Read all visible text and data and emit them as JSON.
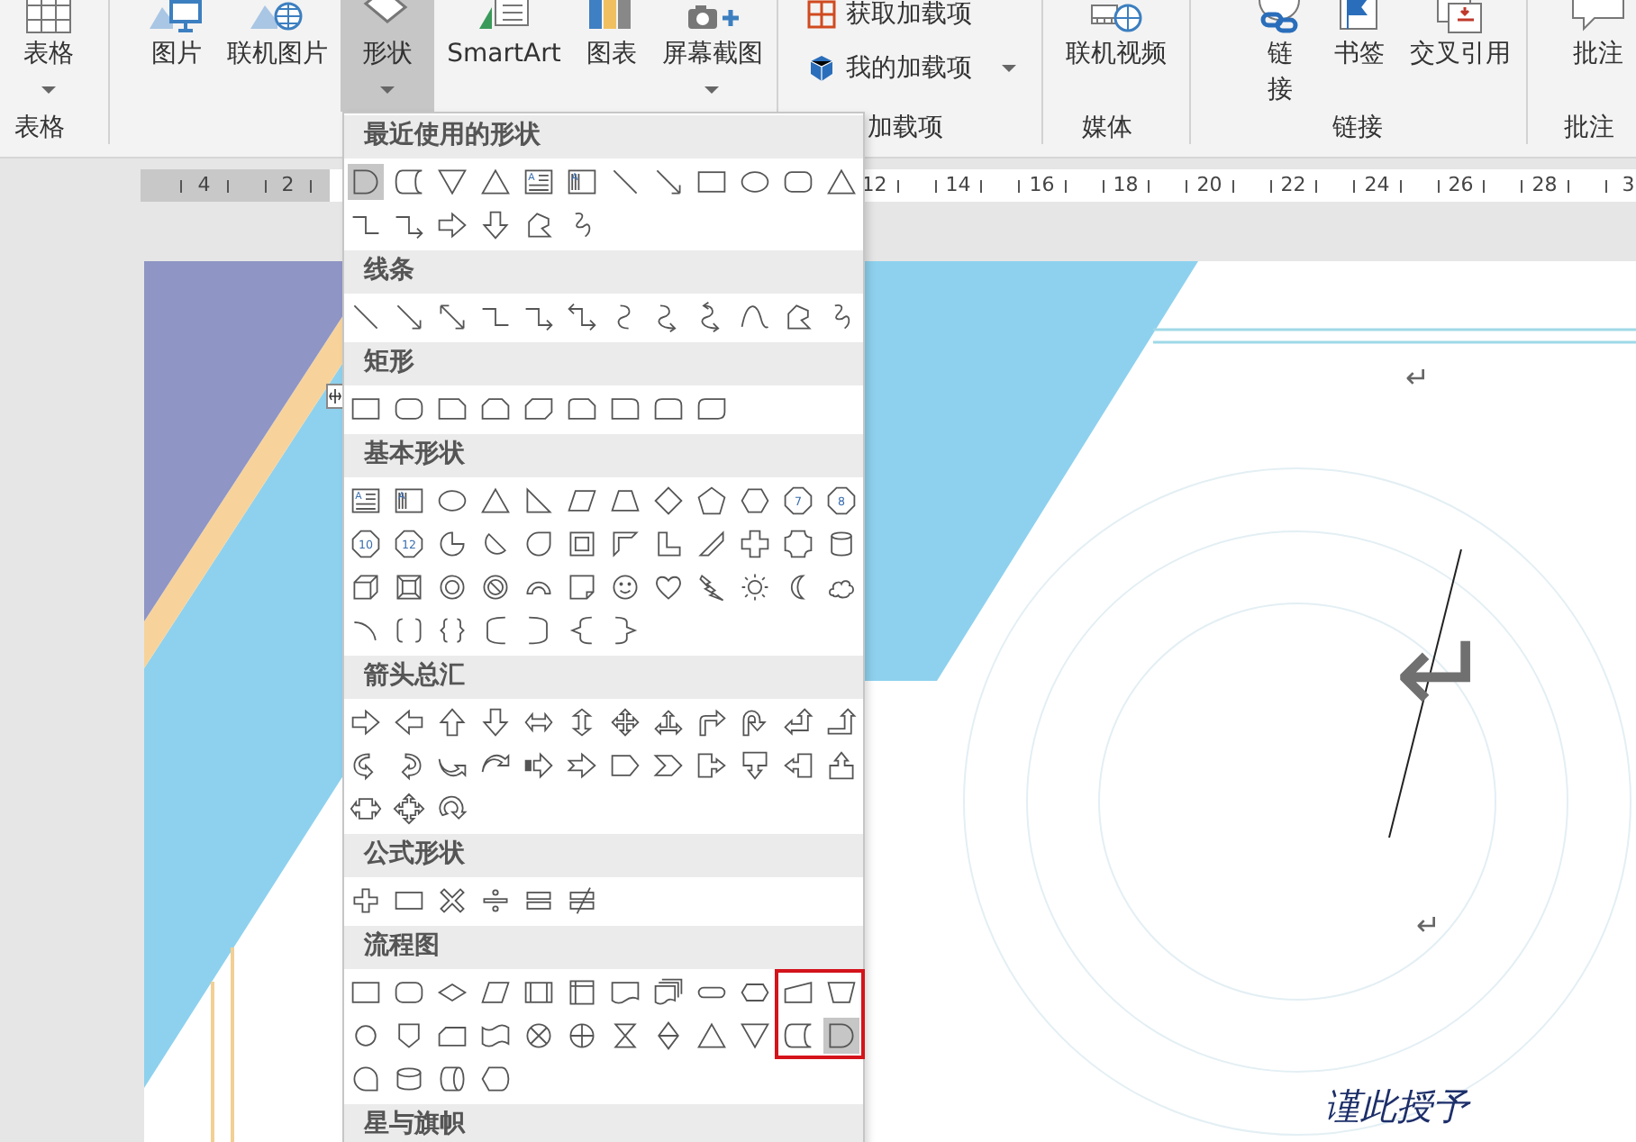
{
  "ribbon": {
    "groups": [
      {
        "label": "表格",
        "buttons": [
          {
            "label": "表格",
            "kind": "table",
            "compact": false,
            "dropdown": true,
            "pressed": false
          }
        ]
      },
      {
        "buttons": [
          {
            "label": "图片",
            "kind": "picture",
            "compact": false,
            "dropdown": false,
            "pressed": false
          },
          {
            "label": "联机图片",
            "kind": "globe-picture",
            "compact": false,
            "dropdown": false,
            "pressed": false
          },
          {
            "label": "形状",
            "kind": "diamond",
            "compact": false,
            "dropdown": true,
            "pressed": true
          },
          {
            "label": "SmartArt",
            "kind": "diagram",
            "compact": false,
            "dropdown": false,
            "pressed": false
          },
          {
            "label": "图表",
            "kind": "bar-chart",
            "compact": false,
            "dropdown": false,
            "pressed": false
          },
          {
            "label": "屏幕截图",
            "kind": "camera",
            "compact": false,
            "dropdown": true,
            "pressed": false
          }
        ]
      },
      {
        "label": "加载项",
        "buttons": [
          {
            "label": "获取加载项",
            "kind": "store",
            "compact": true,
            "dropdown": false,
            "pressed": false
          },
          {
            "label": "我的加载项",
            "kind": "cube",
            "compact": true,
            "dropdown": true,
            "pressed": false
          }
        ]
      },
      {
        "label": "媒体",
        "buttons": [
          {
            "label": "联机视频",
            "kind": "film-globe",
            "compact": false,
            "dropdown": false,
            "pressed": false
          }
        ]
      },
      {
        "label": "链接",
        "buttons": [
          {
            "label": "链接",
            "kind": "chain-link",
            "compact": false,
            "dropdown": false,
            "pressed": false
          },
          {
            "label": "书签",
            "kind": "bookmark",
            "compact": false,
            "dropdown": false,
            "pressed": false
          },
          {
            "label": "交叉引用",
            "kind": "documents",
            "compact": false,
            "dropdown": false,
            "pressed": false
          }
        ]
      },
      {
        "label": "批注",
        "buttons": [
          {
            "label": "批注",
            "kind": "speech-bubble",
            "compact": false,
            "dropdown": false,
            "pressed": false
          }
        ]
      }
    ]
  },
  "ruler": {
    "left_labels": [
      "4",
      "2"
    ],
    "right_labels": [
      "12",
      "14",
      "16",
      "18",
      "20",
      "22",
      "24",
      "26",
      "28",
      "3"
    ]
  },
  "document": {
    "marks": [
      {
        "text": "↵",
        "kind": "paragraph"
      },
      {
        "text": "↵",
        "kind": "large"
      },
      {
        "text": "↵",
        "kind": "paragraph"
      }
    ],
    "text": "谨此授予"
  },
  "menu": {
    "sections": [
      {
        "title": "最近使用的形状",
        "shapes": [
          {
            "kind": "delay",
            "selected": true
          },
          {
            "kind": "stored-data",
            "selected": false
          },
          {
            "kind": "merge-triangle",
            "selected": false
          },
          {
            "kind": "triangle",
            "selected": false
          },
          {
            "kind": "text-box",
            "label": "A",
            "selected": false
          },
          {
            "kind": "vertical-text-box",
            "label": "A",
            "selected": false
          },
          {
            "kind": "line",
            "selected": false
          },
          {
            "kind": "arrow-line",
            "selected": false
          },
          {
            "kind": "rectangle",
            "selected": false
          },
          {
            "kind": "oval",
            "selected": false
          },
          {
            "kind": "rounded-rectangle",
            "selected": false
          },
          {
            "kind": "triangle",
            "selected": false
          },
          {
            "kind": "elbow-connector",
            "selected": false
          },
          {
            "kind": "elbow-arrow",
            "selected": false
          },
          {
            "kind": "right-arrow",
            "selected": false
          },
          {
            "kind": "down-arrow",
            "selected": false
          },
          {
            "kind": "freeform",
            "selected": false
          },
          {
            "kind": "scribble",
            "selected": false
          }
        ]
      },
      {
        "title": "线条",
        "shapes": [
          {
            "kind": "line",
            "selected": false
          },
          {
            "kind": "arrow-line",
            "selected": false
          },
          {
            "kind": "double-arrow-line",
            "selected": false
          },
          {
            "kind": "elbow-connector",
            "selected": false
          },
          {
            "kind": "elbow-arrow",
            "selected": false
          },
          {
            "kind": "elbow-double-arrow",
            "selected": false
          },
          {
            "kind": "curve",
            "selected": false
          },
          {
            "kind": "curved-arrow-line",
            "selected": false
          },
          {
            "kind": "curved-double-arrow-line",
            "selected": false
          },
          {
            "kind": "arch-curve",
            "selected": false
          },
          {
            "kind": "freeform",
            "selected": false
          },
          {
            "kind": "scribble",
            "selected": false
          }
        ]
      },
      {
        "title": "矩形",
        "shapes": [
          {
            "kind": "rectangle",
            "selected": false
          },
          {
            "kind": "rounded-rectangle",
            "selected": false
          },
          {
            "kind": "snip-corner",
            "selected": false
          },
          {
            "kind": "snip-same-side",
            "selected": false
          },
          {
            "kind": "snip-diagonal",
            "selected": false
          },
          {
            "kind": "snip-round",
            "selected": false
          },
          {
            "kind": "round-corner",
            "selected": false
          },
          {
            "kind": "round-same-side",
            "selected": false
          },
          {
            "kind": "round-diagonal",
            "selected": false
          }
        ]
      },
      {
        "title": "基本形状",
        "shapes": [
          {
            "kind": "text-box",
            "label": "A",
            "selected": false
          },
          {
            "kind": "vertical-text-box",
            "label": "A",
            "selected": false
          },
          {
            "kind": "oval",
            "selected": false
          },
          {
            "kind": "triangle",
            "selected": false
          },
          {
            "kind": "right-triangle",
            "selected": false
          },
          {
            "kind": "parallelogram",
            "selected": false
          },
          {
            "kind": "trapezoid",
            "selected": false
          },
          {
            "kind": "diamond",
            "selected": false
          },
          {
            "kind": "pentagon",
            "selected": false
          },
          {
            "kind": "hexagon",
            "selected": false
          },
          {
            "kind": "numbered-polygon",
            "label": "7",
            "selected": false
          },
          {
            "kind": "numbered-polygon",
            "label": "8",
            "selected": false
          },
          {
            "kind": "numbered-polygon",
            "label": "10",
            "selected": false
          },
          {
            "kind": "numbered-polygon",
            "label": "12",
            "selected": false
          },
          {
            "kind": "pie",
            "selected": false
          },
          {
            "kind": "chord",
            "selected": false
          },
          {
            "kind": "teardrop",
            "selected": false
          },
          {
            "kind": "frame",
            "selected": false
          },
          {
            "kind": "half-frame",
            "selected": false
          },
          {
            "kind": "l-shape",
            "selected": false
          },
          {
            "kind": "diagonal-stripe",
            "selected": false
          },
          {
            "kind": "cross",
            "selected": false
          },
          {
            "kind": "plaque",
            "selected": false
          },
          {
            "kind": "cylinder",
            "selected": false
          },
          {
            "kind": "cube",
            "selected": false
          },
          {
            "kind": "bevel",
            "selected": false
          },
          {
            "kind": "donut",
            "selected": false
          },
          {
            "kind": "no-symbol",
            "selected": false
          },
          {
            "kind": "block-arc",
            "selected": false
          },
          {
            "kind": "folded-corner",
            "selected": false
          },
          {
            "kind": "smiley",
            "selected": false
          },
          {
            "kind": "heart",
            "selected": false
          },
          {
            "kind": "lightning",
            "selected": false
          },
          {
            "kind": "sun",
            "selected": false
          },
          {
            "kind": "moon",
            "selected": false
          },
          {
            "kind": "cloud",
            "selected": false
          },
          {
            "kind": "arc",
            "selected": false
          },
          {
            "kind": "bracket-pair",
            "selected": false
          },
          {
            "kind": "brace-pair",
            "selected": false
          },
          {
            "kind": "left-bracket",
            "selected": false
          },
          {
            "kind": "right-bracket",
            "selected": false
          },
          {
            "kind": "left-brace",
            "selected": false
          },
          {
            "kind": "right-brace",
            "selected": false
          }
        ]
      },
      {
        "title": "箭头总汇",
        "shapes": [
          {
            "kind": "right-arrow",
            "selected": false
          },
          {
            "kind": "left-arrow",
            "selected": false
          },
          {
            "kind": "up-arrow",
            "selected": false
          },
          {
            "kind": "down-arrow",
            "selected": false
          },
          {
            "kind": "left-right-arrow",
            "selected": false
          },
          {
            "kind": "up-down-arrow",
            "selected": false
          },
          {
            "kind": "quad-arrow",
            "selected": false
          },
          {
            "kind": "left-right-up-arrow",
            "selected": false
          },
          {
            "kind": "bent-arrow",
            "selected": false
          },
          {
            "kind": "u-turn-arrow",
            "selected": false
          },
          {
            "kind": "left-up-arrow",
            "selected": false
          },
          {
            "kind": "bent-up-arrow",
            "selected": false
          },
          {
            "kind": "curved-right-arrow",
            "selected": false
          },
          {
            "kind": "curved-left-arrow",
            "selected": false
          },
          {
            "kind": "curved-up-arrow",
            "selected": false
          },
          {
            "kind": "curved-down-arrow",
            "selected": false
          },
          {
            "kind": "striped-arrow",
            "selected": false
          },
          {
            "kind": "notched-arrow",
            "selected": false
          },
          {
            "kind": "pentagon-arrow",
            "selected": false
          },
          {
            "kind": "chevron",
            "selected": false
          },
          {
            "kind": "right-callout-arrow",
            "selected": false
          },
          {
            "kind": "down-callout-arrow",
            "selected": false
          },
          {
            "kind": "left-callout-arrow",
            "selected": false
          },
          {
            "kind": "up-callout-arrow",
            "selected": false
          },
          {
            "kind": "left-right-callout-arrow",
            "selected": false
          },
          {
            "kind": "quad-callout-arrow",
            "selected": false
          },
          {
            "kind": "circular-arrow",
            "selected": false
          }
        ]
      },
      {
        "title": "公式形状",
        "shapes": [
          {
            "kind": "plus-sign",
            "selected": false
          },
          {
            "kind": "minus-sign",
            "selected": false
          },
          {
            "kind": "multiply-sign",
            "selected": false
          },
          {
            "kind": "divide-sign",
            "selected": false
          },
          {
            "kind": "equal-sign",
            "selected": false
          },
          {
            "kind": "not-equal-sign",
            "selected": false
          }
        ]
      },
      {
        "title": "流程图",
        "shapes": [
          {
            "kind": "process",
            "selected": false
          },
          {
            "kind": "alternate-process",
            "selected": false
          },
          {
            "kind": "decision",
            "selected": false
          },
          {
            "kind": "data",
            "selected": false
          },
          {
            "kind": "predefined-process",
            "selected": false
          },
          {
            "kind": "internal-storage",
            "selected": false
          },
          {
            "kind": "document",
            "selected": false
          },
          {
            "kind": "multidocument",
            "selected": false
          },
          {
            "kind": "terminator",
            "selected": false
          },
          {
            "kind": "preparation",
            "selected": false
          },
          {
            "kind": "manual-input",
            "selected": false
          },
          {
            "kind": "manual-operation",
            "selected": false
          },
          {
            "kind": "connector",
            "selected": false
          },
          {
            "kind": "off-page-connector",
            "selected": false
          },
          {
            "kind": "card",
            "selected": false
          },
          {
            "kind": "punched-tape",
            "selected": false
          },
          {
            "kind": "summing-junction",
            "selected": false
          },
          {
            "kind": "or-symbol",
            "selected": false
          },
          {
            "kind": "collate",
            "selected": false
          },
          {
            "kind": "sort",
            "selected": false
          },
          {
            "kind": "extract",
            "selected": false
          },
          {
            "kind": "merge-triangle",
            "selected": false
          },
          {
            "kind": "stored-data",
            "selected": false
          },
          {
            "kind": "delay",
            "selected": true
          },
          {
            "kind": "sequential-access",
            "selected": false
          },
          {
            "kind": "magnetic-disk",
            "selected": false
          },
          {
            "kind": "direct-access",
            "selected": false
          },
          {
            "kind": "display",
            "selected": false
          }
        ]
      },
      {
        "title": "星与旗帜"
      }
    ]
  }
}
